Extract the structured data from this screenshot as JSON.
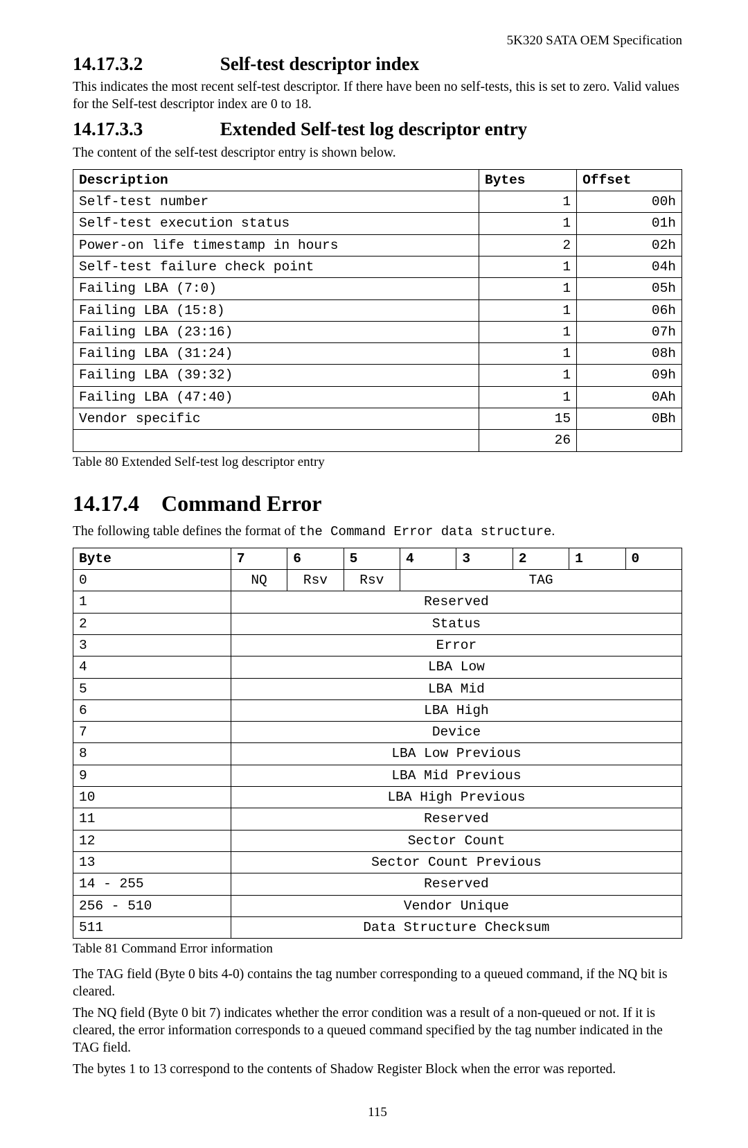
{
  "pageHeader": "5K320 SATA OEM Specification",
  "section1": {
    "number": "14.17.3.2",
    "title": "Self-test descriptor index",
    "para": "This indicates the most recent self-test descriptor. If there have been no self-tests, this is set to zero. Valid values for the Self-test descriptor index are 0 to 18."
  },
  "section2": {
    "number": "14.17.3.3",
    "title": "Extended Self-test log descriptor entry",
    "para": "The content of the self-test descriptor entry is shown below.",
    "headers": {
      "desc": "Description",
      "bytes": "Bytes",
      "offset": "Offset"
    },
    "rows": [
      {
        "desc": "Self-test number",
        "bytes": "1",
        "offset": "00h"
      },
      {
        "desc": "Self-test execution status",
        "bytes": "1",
        "offset": "01h"
      },
      {
        "desc": "Power-on life timestamp in hours",
        "bytes": "2",
        "offset": "02h"
      },
      {
        "desc": "Self-test failure check point",
        "bytes": "1",
        "offset": "04h"
      },
      {
        "desc": "Failing LBA (7:0)",
        "bytes": "1",
        "offset": "05h"
      },
      {
        "desc": "Failing LBA (15:8)",
        "bytes": "1",
        "offset": "06h"
      },
      {
        "desc": "Failing LBA (23:16)",
        "bytes": "1",
        "offset": "07h"
      },
      {
        "desc": "Failing LBA (31:24)",
        "bytes": "1",
        "offset": "08h"
      },
      {
        "desc": "Failing LBA (39:32)",
        "bytes": "1",
        "offset": "09h"
      },
      {
        "desc": "Failing LBA (47:40)",
        "bytes": "1",
        "offset": "0Ah"
      },
      {
        "desc": "Vendor specific",
        "bytes": "15",
        "offset": "0Bh"
      },
      {
        "desc": "",
        "bytes": "26",
        "offset": ""
      }
    ],
    "caption": "Table 80 Extended Self-test log descriptor entry"
  },
  "section3": {
    "number": "14.17.4",
    "title": "Command Error",
    "introPrefix": "The following table defines the format of ",
    "introMono": "the Command Error data structure",
    "introSuffix": ".",
    "headers": {
      "byte": "Byte",
      "b7": "7",
      "b6": "6",
      "b5": "5",
      "b4": "4",
      "b3": "3",
      "b2": "2",
      "b1": "1",
      "b0": "0"
    },
    "row0": {
      "byte": "0",
      "nq": "NQ",
      "rsv1": "Rsv",
      "rsv2": "Rsv",
      "tag": "TAG"
    },
    "rows": [
      {
        "byte": "1",
        "content": "Reserved"
      },
      {
        "byte": "2",
        "content": "Status"
      },
      {
        "byte": "3",
        "content": "Error"
      },
      {
        "byte": "4",
        "content": "LBA Low"
      },
      {
        "byte": "5",
        "content": "LBA Mid"
      },
      {
        "byte": "6",
        "content": "LBA High"
      },
      {
        "byte": "7",
        "content": "Device"
      },
      {
        "byte": "8",
        "content": "LBA Low Previous"
      },
      {
        "byte": "9",
        "content": "LBA Mid Previous"
      },
      {
        "byte": "10",
        "content": "LBA High Previous"
      },
      {
        "byte": "11",
        "content": "Reserved"
      },
      {
        "byte": "12",
        "content": "Sector Count"
      },
      {
        "byte": "13",
        "content": "Sector Count Previous"
      },
      {
        "byte": "14 - 255",
        "content": "Reserved"
      },
      {
        "byte": "256 - 510",
        "content": "Vendor Unique"
      },
      {
        "byte": "511",
        "content": "Data Structure Checksum"
      }
    ],
    "caption": "Table 81 Command Error information",
    "para1": "The TAG field (Byte 0 bits 4-0) contains the tag number corresponding to a queued command, if the NQ bit is cleared.",
    "para2": "The NQ field (Byte 0 bit 7) indicates whether the error condition was a result of a non-queued or not. If it is cleared, the error information corresponds to a queued command specified by the tag number indicated in the TAG field.",
    "para3": "The bytes 1 to 13 correspond to the contents of Shadow Register Block when the error was reported."
  },
  "pageNumber": "115",
  "chart_data": [
    {
      "type": "table",
      "title": "Extended Self-test log descriptor entry",
      "columns": [
        "Description",
        "Bytes",
        "Offset"
      ],
      "rows": [
        [
          "Self-test number",
          1,
          "00h"
        ],
        [
          "Self-test execution status",
          1,
          "01h"
        ],
        [
          "Power-on life timestamp in hours",
          2,
          "02h"
        ],
        [
          "Self-test failure check point",
          1,
          "04h"
        ],
        [
          "Failing LBA (7:0)",
          1,
          "05h"
        ],
        [
          "Failing LBA (15:8)",
          1,
          "06h"
        ],
        [
          "Failing LBA (23:16)",
          1,
          "07h"
        ],
        [
          "Failing LBA (31:24)",
          1,
          "08h"
        ],
        [
          "Failing LBA (39:32)",
          1,
          "09h"
        ],
        [
          "Failing LBA (47:40)",
          1,
          "0Ah"
        ],
        [
          "Vendor specific",
          15,
          "0Bh"
        ],
        [
          "",
          26,
          ""
        ]
      ]
    },
    {
      "type": "table",
      "title": "Command Error information (bit layout)",
      "columns": [
        "Byte",
        "7",
        "6",
        "5",
        "4",
        "3",
        "2",
        "1",
        "0"
      ],
      "rows": [
        [
          "0",
          "NQ",
          "Rsv",
          "Rsv",
          "TAG",
          "TAG",
          "TAG",
          "TAG",
          "TAG"
        ],
        [
          "1",
          "Reserved"
        ],
        [
          "2",
          "Status"
        ],
        [
          "3",
          "Error"
        ],
        [
          "4",
          "LBA Low"
        ],
        [
          "5",
          "LBA Mid"
        ],
        [
          "6",
          "LBA High"
        ],
        [
          "7",
          "Device"
        ],
        [
          "8",
          "LBA Low Previous"
        ],
        [
          "9",
          "LBA Mid Previous"
        ],
        [
          "10",
          "LBA High Previous"
        ],
        [
          "11",
          "Reserved"
        ],
        [
          "12",
          "Sector Count"
        ],
        [
          "13",
          "Sector Count Previous"
        ],
        [
          "14 - 255",
          "Reserved"
        ],
        [
          "256 - 510",
          "Vendor Unique"
        ],
        [
          "511",
          "Data Structure Checksum"
        ]
      ]
    }
  ]
}
